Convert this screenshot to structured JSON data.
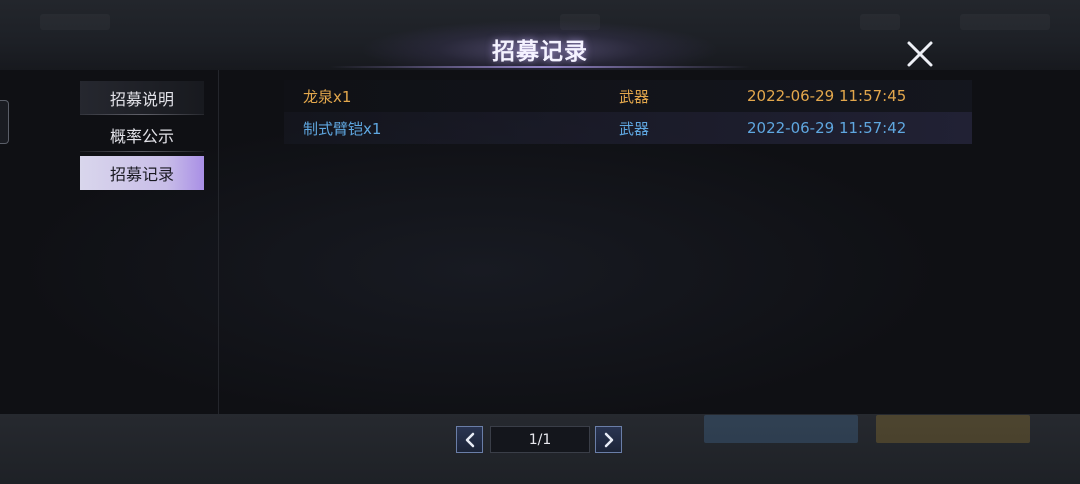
{
  "header": {
    "title": "招募记录"
  },
  "sidebar": {
    "items": [
      {
        "label": "招募说明",
        "active": false
      },
      {
        "label": "概率公示",
        "active": false
      },
      {
        "label": "招募记录",
        "active": true
      }
    ]
  },
  "records": [
    {
      "name": "龙泉x1",
      "type": "武器",
      "time": "2022-06-29 11:57:45",
      "color": "#e3a74c"
    },
    {
      "name": "制式臂铠x1",
      "type": "武器",
      "time": "2022-06-29 11:57:42",
      "color": "#5fa7e0"
    }
  ],
  "pagination": {
    "page_display": "1/1"
  },
  "icons": {
    "close": "close-icon",
    "prev": "chevron-left-icon",
    "next": "chevron-right-icon"
  }
}
